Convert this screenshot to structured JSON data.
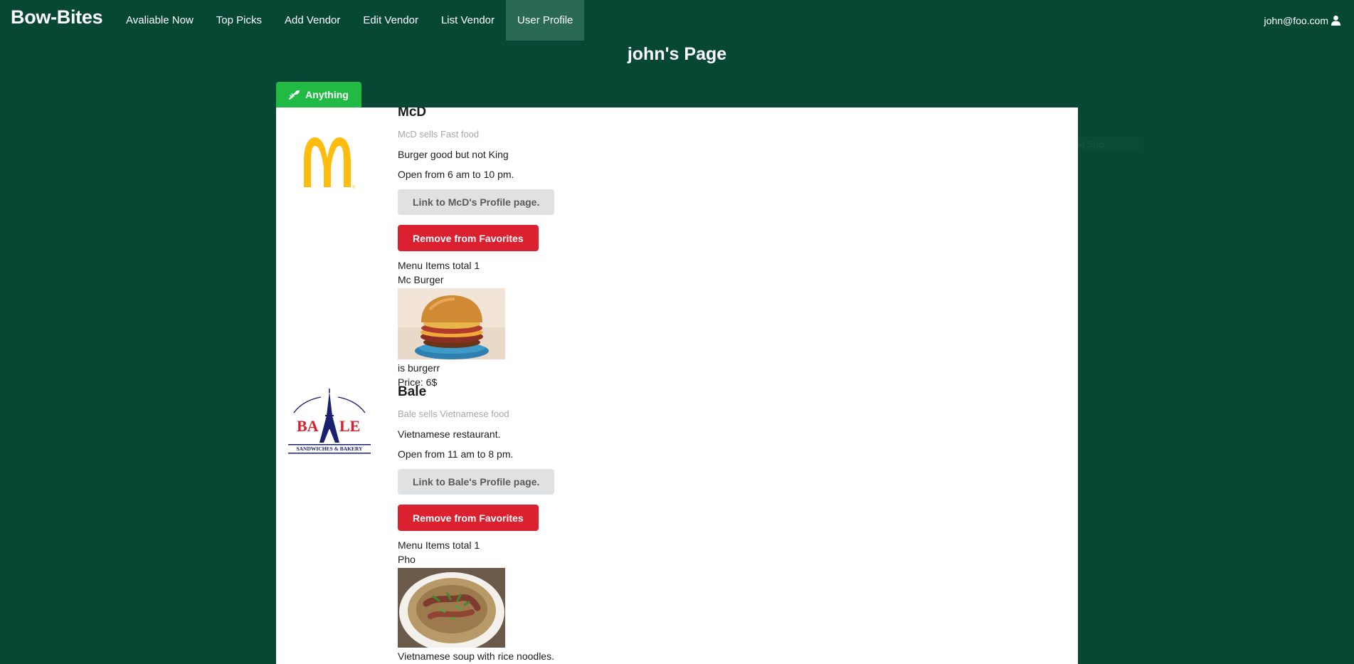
{
  "nav": {
    "brand": "Bow-Bites",
    "items": [
      {
        "label": "Avaliable Now"
      },
      {
        "label": "Top Picks"
      },
      {
        "label": "Add Vendor"
      },
      {
        "label": "Edit Vendor"
      },
      {
        "label": "List Vendor"
      },
      {
        "label": "User Profile",
        "active": true
      }
    ],
    "user_email": "john@foo.com",
    "user_icon": "user-icon"
  },
  "page": {
    "title": "john's Page",
    "filter_button": {
      "label": "Anything",
      "icon": "utensils-icon"
    }
  },
  "ghost_chip": {
    "label": "Rectangular Snip"
  },
  "vendors": [
    {
      "name": "McD",
      "subtitle": "McD sells Fast food",
      "description": "Burger good but not King",
      "hours": "Open from 6 am to 10 pm.",
      "profile_button": "Link to McD's Profile page.",
      "remove_button": "Remove from Favorites",
      "menu_total": "Menu Items total 1",
      "menu_item": {
        "name": "Mc Burger",
        "image": "burger-photo",
        "description": "is burgerr",
        "price": "Price: 6$"
      },
      "logo": "mcdonalds-arches-logo",
      "colors": {
        "logo": "#ffbc0d"
      }
    },
    {
      "name": "Bale",
      "subtitle": "Bale sells Vietnamese food",
      "description": "Vietnamese restaurant.",
      "hours": "Open from 11 am to 8 pm.",
      "profile_button": "Link to Bale's Profile page.",
      "remove_button": "Remove from Favorites",
      "menu_total": "Menu Items total 1",
      "menu_item": {
        "name": "Pho",
        "image": "pho-photo",
        "description": "Vietnamese soup with rice noodles."
      },
      "logo": "bale-eiffel-logo",
      "logo_text": {
        "left": "BA",
        "right": "LE",
        "tagline": "SANDWICHES & BAKERY"
      },
      "colors": {
        "logo_red": "#d8202a",
        "logo_navy": "#1a1f6e"
      }
    }
  ],
  "colors": {
    "background": "#064833",
    "nav_active": "#2a6a55",
    "filter_green": "#21ba45",
    "remove_red": "#db2130",
    "profile_grey": "#e0e1e2"
  }
}
